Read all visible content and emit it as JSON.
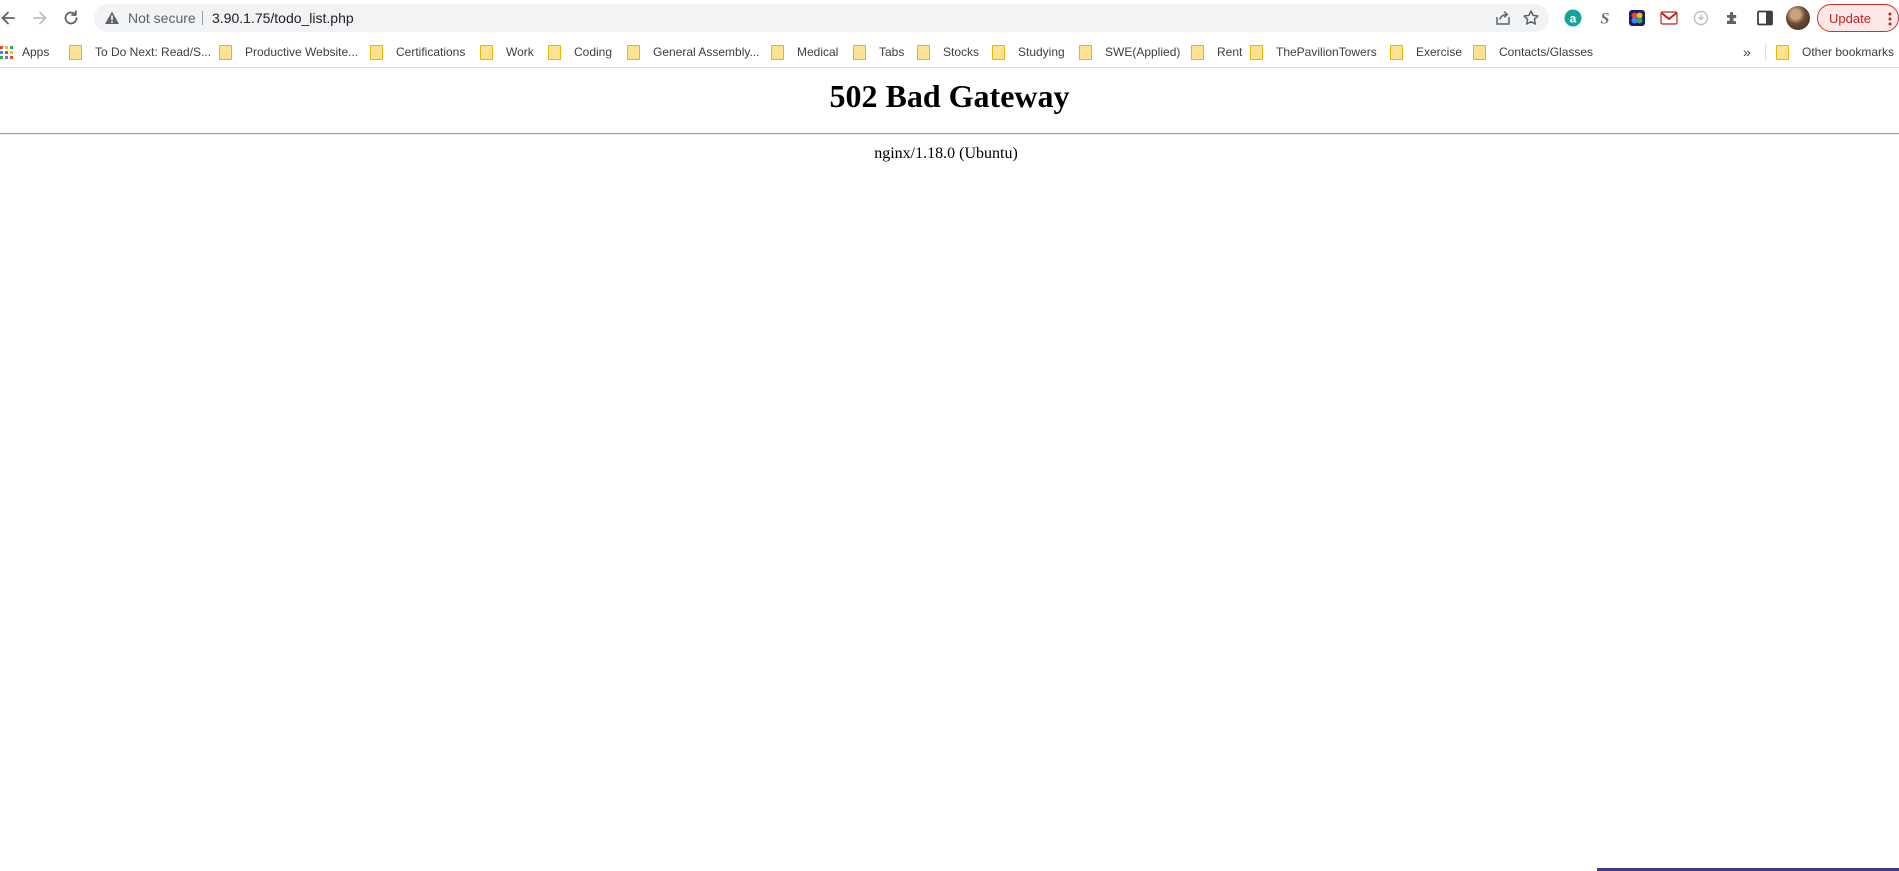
{
  "browser": {
    "omnibox": {
      "security_label": "Not secure",
      "url": "3.90.1.75/todo_list.php"
    },
    "update_button": {
      "label": "Update",
      "color": "#d93025"
    },
    "extensions": [
      {
        "icon": "amazon-assistant-icon",
        "color": "#16a39a"
      },
      {
        "icon": "s-extension-icon",
        "color": "#6f6f6f"
      },
      {
        "icon": "colorful-extension-icon",
        "color": "#1a1a6e"
      },
      {
        "icon": "gmail-icon",
        "color": "#c5221f"
      },
      {
        "icon": "circle-extension-icon",
        "color": "#bdc1c6"
      },
      {
        "icon": "puzzle-icon",
        "color": "#5f6368"
      },
      {
        "icon": "side-panel-icon",
        "color": "#3c4043"
      }
    ]
  },
  "bookmarks": {
    "apps_label": "Apps",
    "items": [
      "To Do Next: Read/S...",
      "Productive Website...",
      "Certifications",
      "Work",
      "Coding",
      "General Assembly...",
      "Medical",
      "Tabs",
      "Stocks",
      "Studying",
      "SWE(Applied)",
      "Rent",
      "ThePavilionTowers",
      "Exercise",
      "Contacts/Glasses"
    ],
    "overflow_label": "»",
    "other_label": "Other bookmarks",
    "folder_color": "#fde293"
  },
  "page": {
    "title": "502 Bad Gateway",
    "server": "nginx/1.18.0 (Ubuntu)"
  }
}
